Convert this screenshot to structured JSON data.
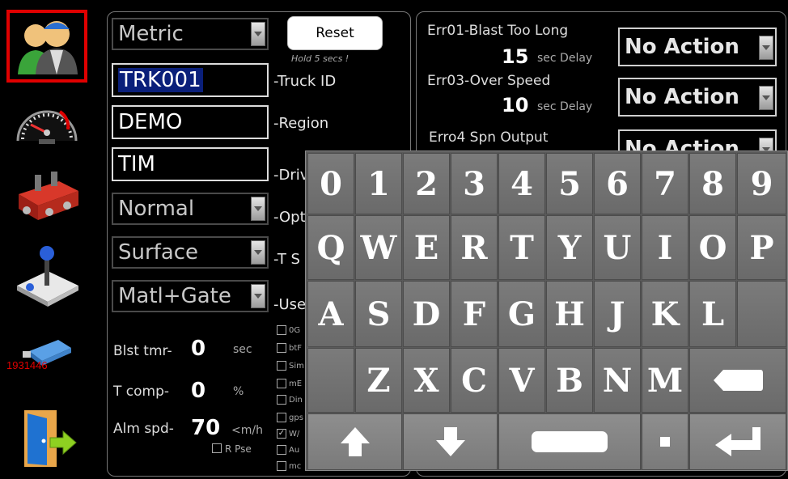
{
  "sidebar": {
    "items": [
      {
        "name": "users-icon"
      },
      {
        "name": "speedometer-icon"
      },
      {
        "name": "valve-block-icon"
      },
      {
        "name": "joystick-icon"
      },
      {
        "name": "usb-drive-icon",
        "label": "1931446"
      },
      {
        "name": "exit-door-icon"
      }
    ]
  },
  "settings": {
    "units": "Metric",
    "reset_label": "Reset",
    "hold_note": "Hold 5 secs !",
    "truck_id": "TRK001",
    "truck_id_label": "-Truck ID",
    "region": "DEMO",
    "region_label": "-Region",
    "driver": "TIM",
    "driver_label": "-Driv",
    "option": "Normal",
    "option_label": "-Opt",
    "t_select": "Surface",
    "t_select_label": "-T S",
    "use": "Matl+Gate",
    "use_label": "-Use",
    "blst_label": "Blst tmr-",
    "blst_value": "0",
    "blst_unit": "sec",
    "tcomp_label": "T comp-",
    "tcomp_value": "0",
    "tcomp_unit": "%",
    "alm_label": "Alm spd-",
    "alm_value": "70",
    "alm_unit": "<m/h",
    "rpse_label": "R Pse",
    "checks": [
      "0G",
      "btF",
      "Sim",
      "mE",
      "Din",
      "gps",
      "W/",
      "Au",
      "mc"
    ]
  },
  "errors": {
    "err01_label": "Err01-Blast Too Long",
    "err01_delay": "15",
    "err03_label": "Err03-Over Speed",
    "err03_delay": "10",
    "delay_unit": "sec Delay",
    "err04_label": "Erro4 Spn Output",
    "action1": "No Action",
    "action2": "No Action",
    "action3": "No Action"
  },
  "keyboard": {
    "row1": [
      "0",
      "1",
      "2",
      "3",
      "4",
      "5",
      "6",
      "7",
      "8",
      "9"
    ],
    "row2": [
      "Q",
      "W",
      "E",
      "R",
      "T",
      "Y",
      "U",
      "I",
      "O",
      "P"
    ],
    "row3": [
      "A",
      "S",
      "D",
      "F",
      "G",
      "H",
      "J",
      "K",
      "L"
    ],
    "row4": [
      "Z",
      "X",
      "C",
      "V",
      "B",
      "N",
      "M"
    ]
  }
}
